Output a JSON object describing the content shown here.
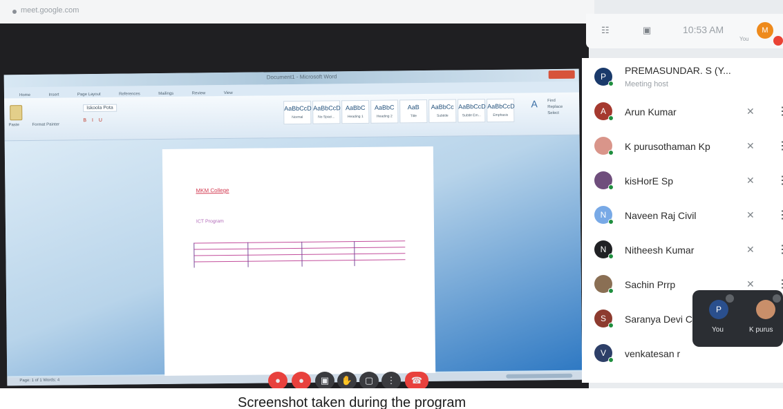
{
  "browser": {
    "url": "meet.google.com"
  },
  "meet_header": {
    "time": "10:53 AM",
    "self_label": "You",
    "self_initial": "M"
  },
  "word": {
    "title": "Document1 - Microsoft Word",
    "tabs": [
      "Home",
      "Insert",
      "Page Layout",
      "References",
      "Mailings",
      "Review",
      "View"
    ],
    "font": "Iskoola Pota",
    "paste_label": "Paste",
    "format_painter_label": "Format Painter",
    "styles": [
      {
        "sample": "AaBbCcD",
        "name": "Normal"
      },
      {
        "sample": "AaBbCcD",
        "name": "No Spaci..."
      },
      {
        "sample": "AaBbC",
        "name": "Heading 1"
      },
      {
        "sample": "AaBbC",
        "name": "Heading 2"
      },
      {
        "sample": "AaB",
        "name": "Title"
      },
      {
        "sample": "AaBbCc",
        "name": "Subtitle"
      },
      {
        "sample": "AaBbCcD",
        "name": "Subtle Em..."
      },
      {
        "sample": "AaBbCcD",
        "name": "Emphasis"
      }
    ],
    "change_styles": "Change Styles",
    "editing": [
      "Find",
      "Replace",
      "Select"
    ],
    "heading_text": "MKM College",
    "subheading_text": "ICT Program",
    "status_text": "Page: 1 of 1   Words: 4"
  },
  "controls": {
    "mic": "mic-off-icon",
    "cam": "cam-off-icon",
    "cc": "captions-icon",
    "hand": "raise-hand-icon",
    "present": "present-icon",
    "more": "more-icon",
    "leave": "leave-call-icon"
  },
  "caption": "Screenshot taken during the program",
  "participants": [
    {
      "initial": "P",
      "name": "PREMASUNDAR. S (Y...",
      "role": "Meeting host",
      "color": "#1a3a6b",
      "host": true
    },
    {
      "initial": "A",
      "name": "Arun Kumar",
      "color": "#a5392f"
    },
    {
      "initial": "",
      "name": "K purusothaman Kp",
      "color": "#d9958a"
    },
    {
      "initial": "",
      "name": "kisHorE Sp",
      "color": "#6f4e7c"
    },
    {
      "initial": "N",
      "name": "Naveen Raj Civil",
      "color": "#78a9e6"
    },
    {
      "initial": "N",
      "name": "Nitheesh Kumar",
      "color": "#202124"
    },
    {
      "initial": "",
      "name": "Sachin Prrp",
      "color": "#8a6f54"
    },
    {
      "initial": "S",
      "name": "Saranya Devi C",
      "color": "#8d3b2f"
    },
    {
      "initial": "V",
      "name": "venkatesan r",
      "color": "#2d3f68"
    }
  ],
  "tiles": [
    {
      "initial": "P",
      "label": "You",
      "color": "#2a4f8d"
    },
    {
      "initial": "",
      "label": "K purus",
      "color": "#c98f6a"
    }
  ]
}
